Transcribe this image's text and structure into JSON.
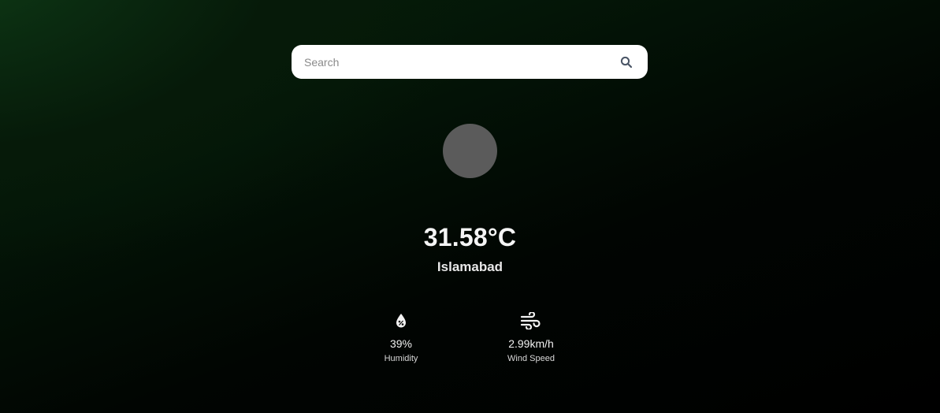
{
  "search": {
    "placeholder": "Search",
    "value": "",
    "button_icon": "search-icon"
  },
  "weather": {
    "icon": "weather-condition-icon",
    "temperature": "31.58°C",
    "city": "Islamabad"
  },
  "stats": {
    "humidity": {
      "icon": "humidity-icon",
      "value": "39%",
      "label": "Humidity"
    },
    "wind": {
      "icon": "wind-icon",
      "value": "2.99km/h",
      "label": "Wind Speed"
    }
  },
  "colors": {
    "background_accent": "#0f3d16",
    "background_dark": "#000000",
    "search_bg": "#ffffff",
    "weather_icon_placeholder": "#5b5b5b",
    "text": "#f5f5f5"
  }
}
